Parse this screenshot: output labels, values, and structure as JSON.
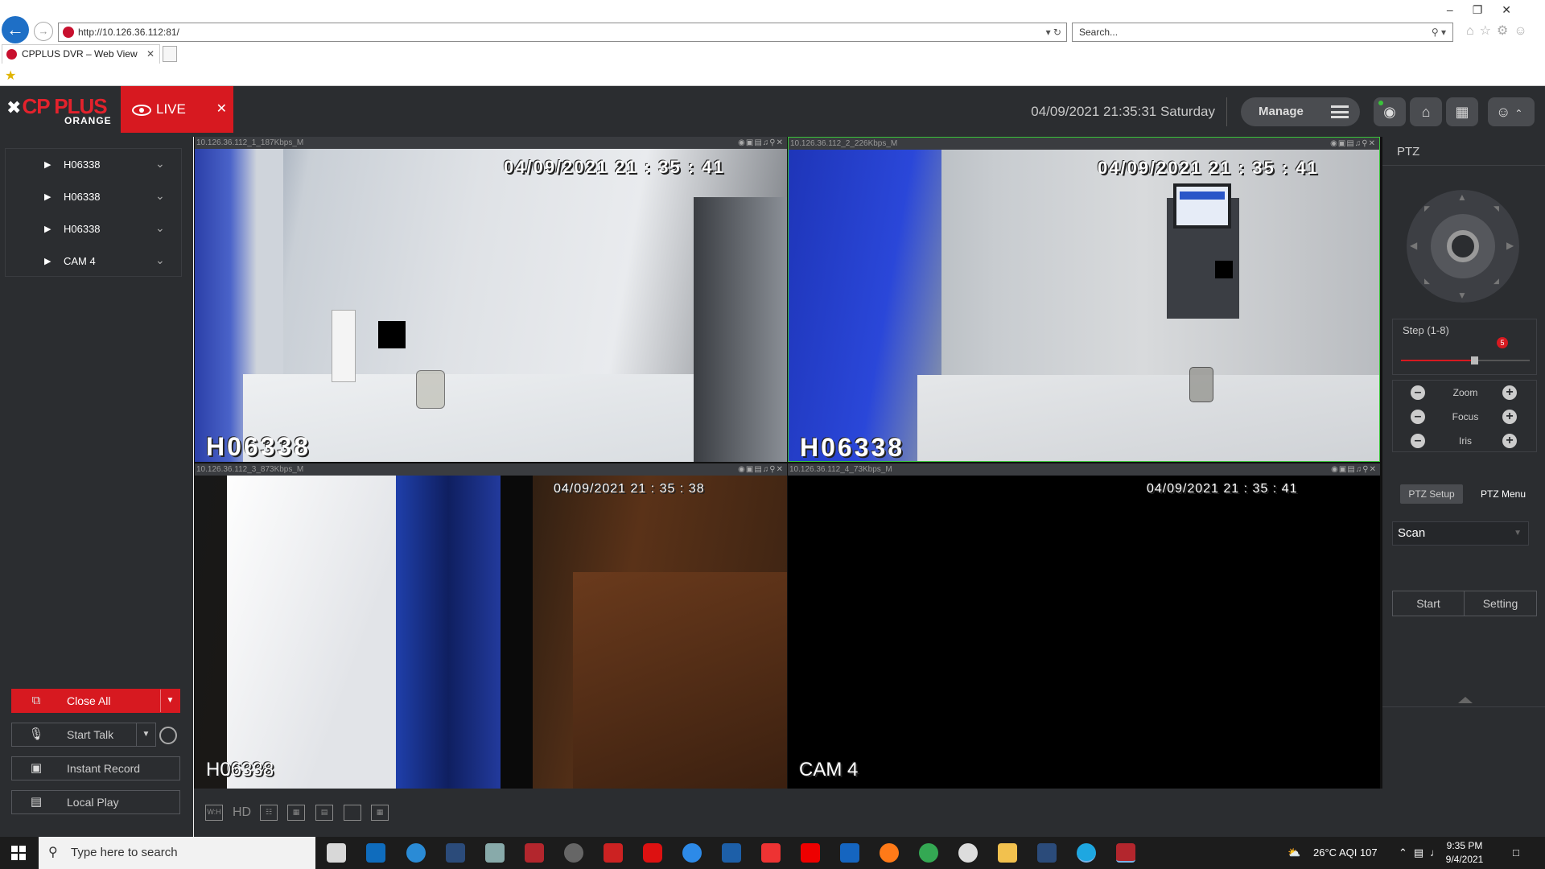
{
  "browser": {
    "address": "http://10.126.36.112:81/",
    "search_placeholder": "Search...",
    "tab_title": "CPPLUS DVR – Web View"
  },
  "header": {
    "logo_main": "CP PLUS",
    "logo_sub": "ORANGE",
    "live_label": "LIVE",
    "datetime": "04/09/2021 21:35:31 Saturday",
    "manage_label": "Manage"
  },
  "device_tree": [
    {
      "label": "H06338"
    },
    {
      "label": "H06338"
    },
    {
      "label": "H06338"
    },
    {
      "label": "CAM 4"
    }
  ],
  "left_buttons": {
    "close_all": "Close All",
    "start_talk": "Start Talk",
    "instant_record": "Instant Record",
    "local_play": "Local Play"
  },
  "channels": [
    {
      "stream": "10.126.36.112_1_187Kbps_M",
      "timestamp": "04/09/2021  21 : 35 : 41",
      "osd": "H06338"
    },
    {
      "stream": "10.126.36.112_2_226Kbps_M",
      "timestamp": "04/09/2021  21 : 35 : 41",
      "osd": "H06338"
    },
    {
      "stream": "10.126.36.112_3_873Kbps_M",
      "timestamp": "04/09/2021  21 : 35 : 38",
      "osd": "H06338"
    },
    {
      "stream": "10.126.36.112_4_73Kbps_M",
      "timestamp": "04/09/2021  21 : 35 : 41",
      "osd": "CAM 4"
    }
  ],
  "toolbar": {
    "hd_label": "HD",
    "wh_label": "W:H"
  },
  "ptz": {
    "title": "PTZ",
    "step_label": "Step (1-8)",
    "step_value": "5",
    "zoom": "Zoom",
    "focus": "Focus",
    "iris": "Iris",
    "tab_setup": "PTZ Setup",
    "tab_menu": "PTZ Menu",
    "scan_value": "Scan",
    "start": "Start",
    "setting": "Setting"
  },
  "taskbar": {
    "search_placeholder": "Type here to search",
    "weather": "26°C  AQI 107",
    "time": "9:35 PM",
    "date": "9/4/2021"
  }
}
